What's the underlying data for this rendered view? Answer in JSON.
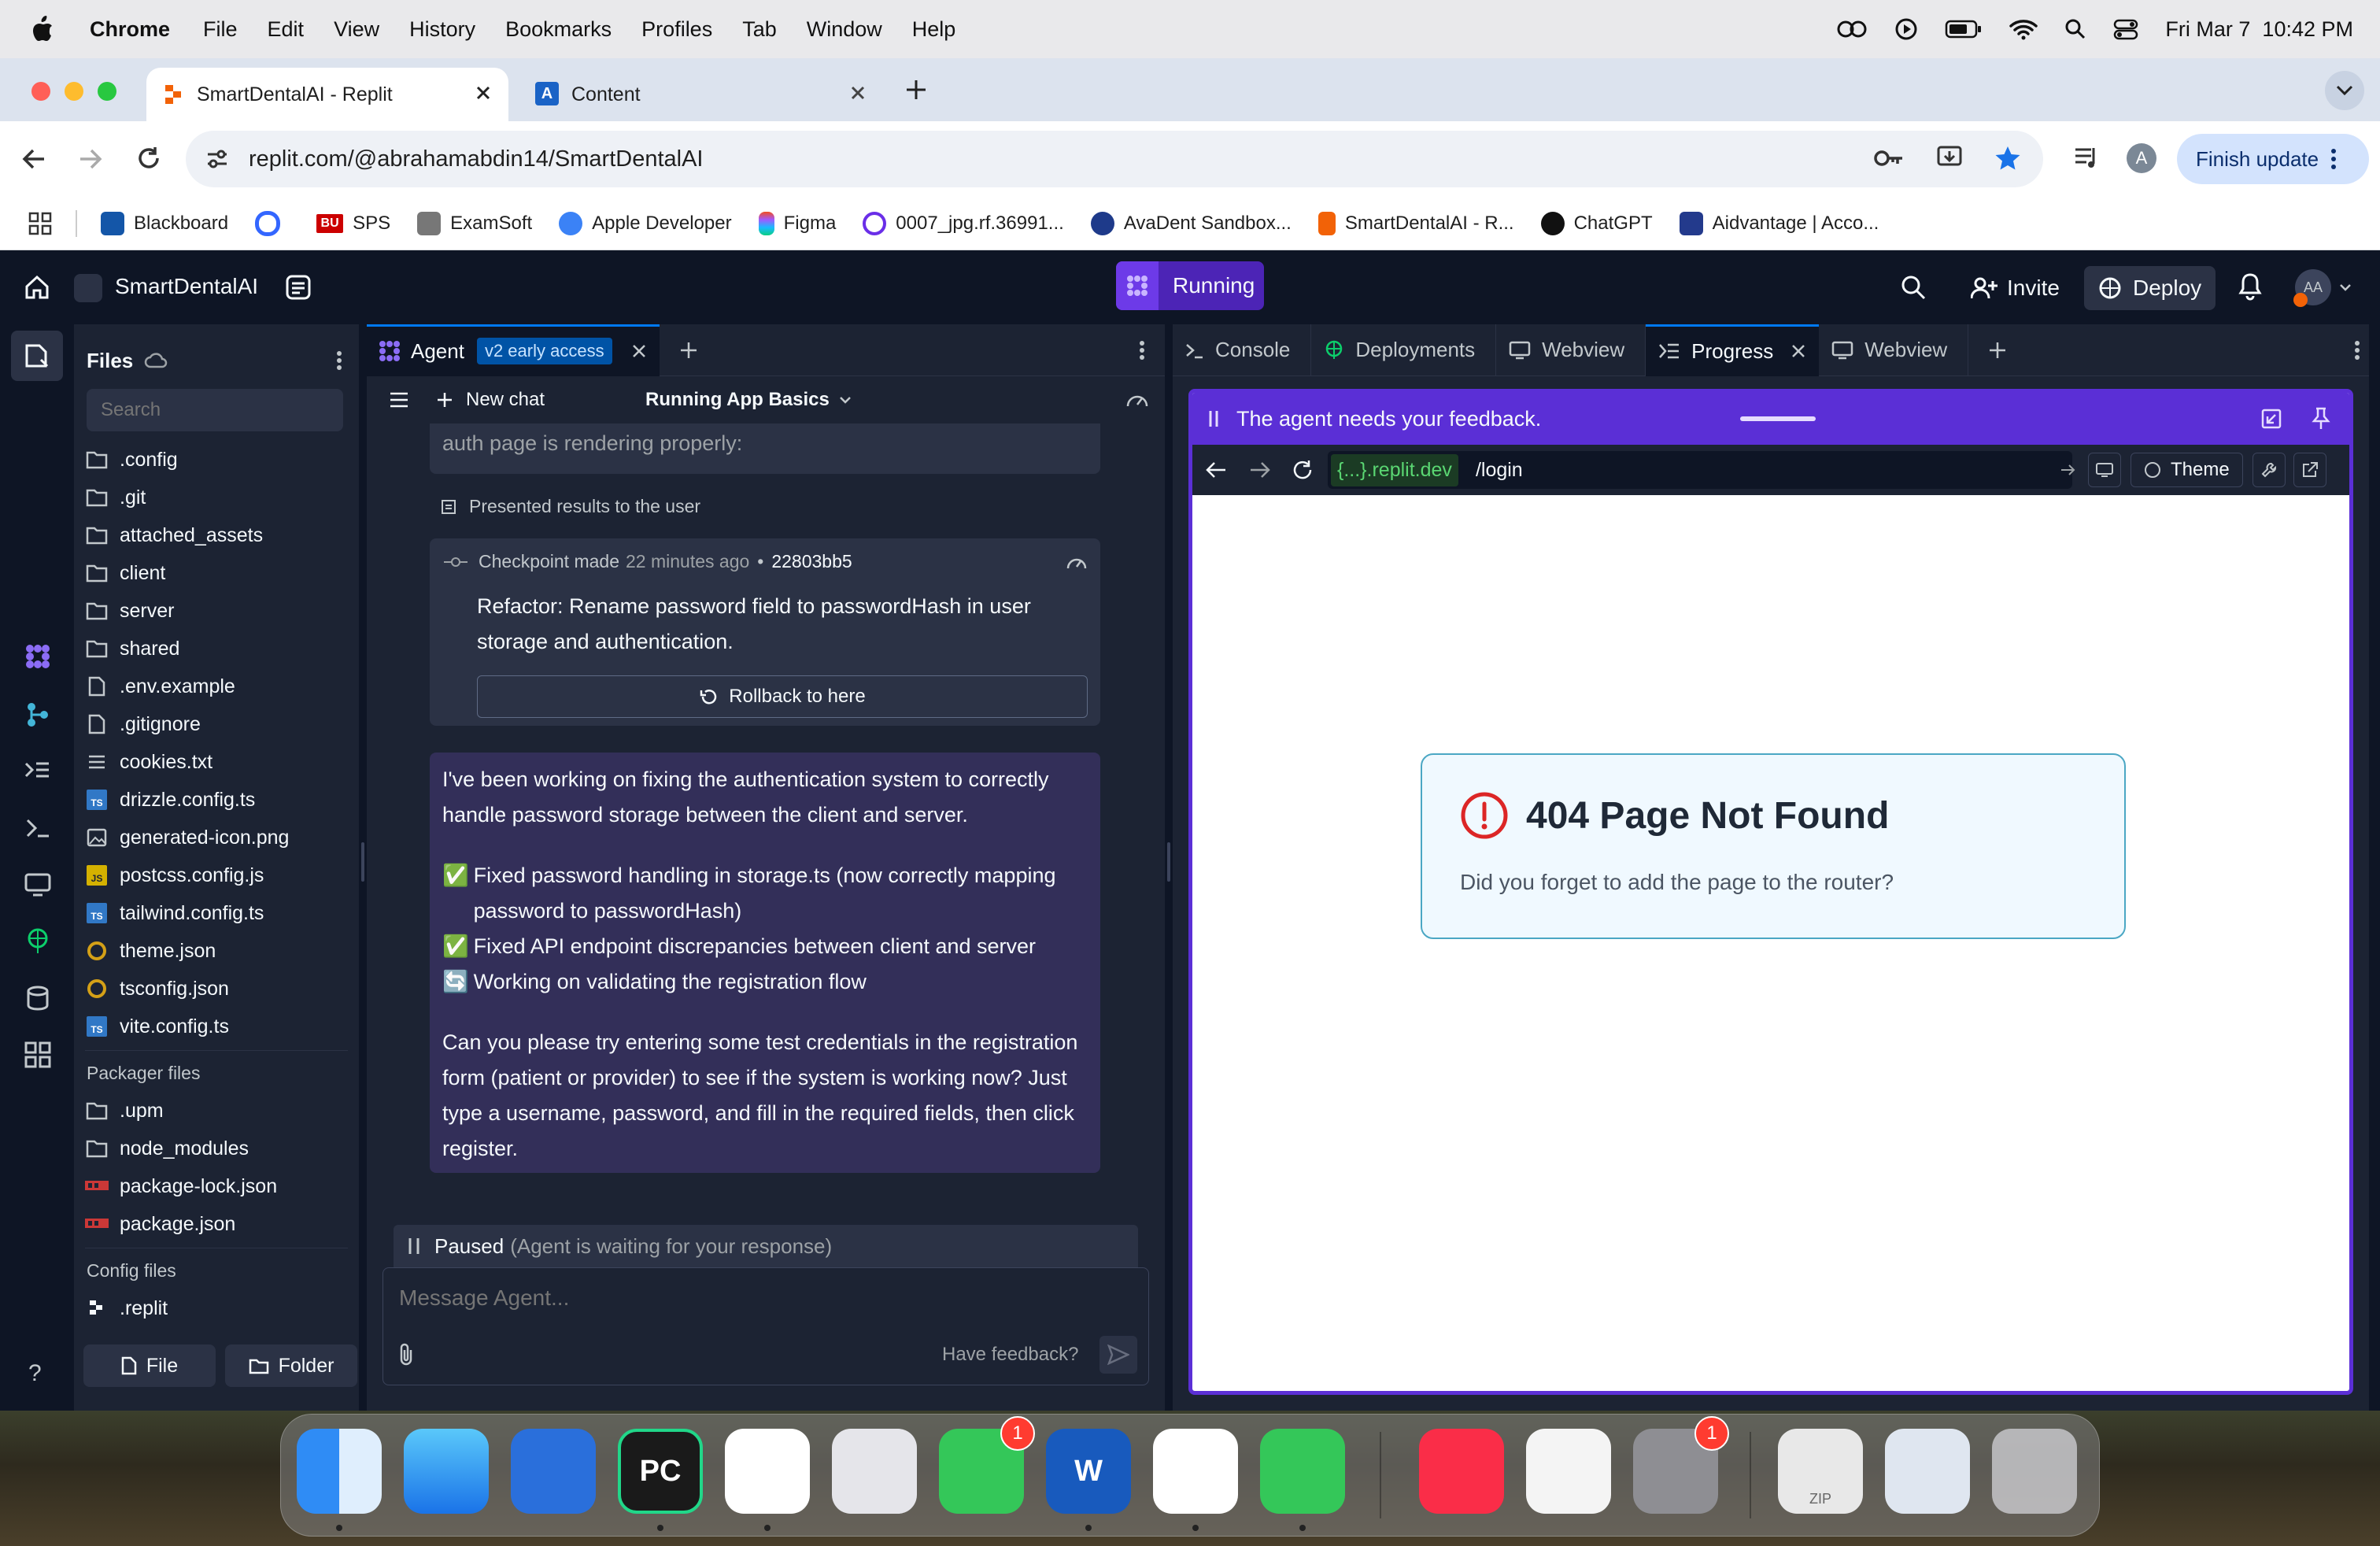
{
  "menubar": {
    "app": "Chrome",
    "items": [
      "File",
      "Edit",
      "View",
      "History",
      "Bookmarks",
      "Profiles",
      "Tab",
      "Window",
      "Help"
    ],
    "clock": "Fri Mar 7  10:42 PM"
  },
  "browser": {
    "tabs": [
      {
        "title": "SmartDentalAI - Replit",
        "active": true
      },
      {
        "title": "Content",
        "active": false
      }
    ],
    "url": "replit.com/@abrahamabdin14/SmartDentalAI",
    "profile_initial": "A",
    "finish_update": "Finish update",
    "bookmarks": [
      "Blackboard",
      "SPS",
      "ExamSoft",
      "Apple Developer",
      "Figma",
      "0007_jpg.rf.36991...",
      "AvaDent Sandbox...",
      "SmartDentalAI - R...",
      "ChatGPT",
      "Aidvantage | Acco..."
    ]
  },
  "replit": {
    "project_name": "SmartDentalAI",
    "run_label": "Running",
    "invite_label": "Invite",
    "deploy_label": "Deploy",
    "user_initials": "AA",
    "files": {
      "title": "Files",
      "search_placeholder": "Search",
      "items": [
        {
          "name": ".config",
          "icon": "folder-icon"
        },
        {
          "name": ".git",
          "icon": "folder-icon"
        },
        {
          "name": "attached_assets",
          "icon": "folder-icon"
        },
        {
          "name": "client",
          "icon": "folder-icon"
        },
        {
          "name": "server",
          "icon": "folder-icon"
        },
        {
          "name": "shared",
          "icon": "folder-icon"
        },
        {
          "name": ".env.example",
          "icon": "file-icon"
        },
        {
          "name": ".gitignore",
          "icon": "file-icon"
        },
        {
          "name": "cookies.txt",
          "icon": "text-file-icon"
        },
        {
          "name": "drizzle.config.ts",
          "icon": "ts-file-icon"
        },
        {
          "name": "generated-icon.png",
          "icon": "image-file-icon"
        },
        {
          "name": "postcss.config.js",
          "icon": "js-file-icon"
        },
        {
          "name": "tailwind.config.ts",
          "icon": "ts-file-icon"
        },
        {
          "name": "theme.json",
          "icon": "json-file-icon"
        },
        {
          "name": "tsconfig.json",
          "icon": "json-file-icon"
        },
        {
          "name": "vite.config.ts",
          "icon": "ts-file-icon"
        }
      ],
      "packager_title": "Packager files",
      "packager_items": [
        {
          "name": ".upm",
          "icon": "folder-icon"
        },
        {
          "name": "node_modules",
          "icon": "folder-icon"
        },
        {
          "name": "package-lock.json",
          "icon": "npm-file-icon"
        },
        {
          "name": "package.json",
          "icon": "npm-file-icon"
        }
      ],
      "config_title": "Config files",
      "config_items": [
        {
          "name": ".replit",
          "icon": "replit-file-icon"
        }
      ],
      "new_file_label": "File",
      "new_folder_label": "Folder"
    },
    "agent": {
      "tab_label": "Agent",
      "tab_badge": "v2 early access",
      "new_chat": "New chat",
      "chat_title": "Running App Basics",
      "prev_text": "auth page is rendering properly:",
      "presented": "Presented results to the user",
      "checkpoint_label": "Checkpoint made",
      "checkpoint_time": "22 minutes ago",
      "checkpoint_sep": "•",
      "checkpoint_hash": "22803bb5",
      "checkpoint_desc": "Refactor: Rename password field to passwordHash in user storage and authentication.",
      "rollback_label": "Rollback to here",
      "msg_intro": "I've been working on fixing the authentication system to correctly handle password storage between the client and server.",
      "msg_items": [
        {
          "icon": "✅",
          "text": "Fixed password handling in storage.ts (now correctly mapping password to passwordHash)"
        },
        {
          "icon": "✅",
          "text": "Fixed API endpoint discrepancies between client and server"
        },
        {
          "icon": "🔄",
          "text": "Working on validating the registration flow"
        }
      ],
      "msg_outro": "Can you please try entering some test credentials in the registration form (patient or provider) to see if the system is working now? Just type a username, password, and fill in the required fields, then click register.",
      "paused_label": "Paused",
      "paused_note": "(Agent is waiting for your response)",
      "input_placeholder": "Message Agent...",
      "feedback_label": "Have feedback?"
    },
    "right_tabs": [
      "Console",
      "Deployments",
      "Webview",
      "Progress",
      "Webview"
    ],
    "banner": "The agent needs your feedback.",
    "webview": {
      "domain": "{...}.replit.dev",
      "path": "/login",
      "theme_label": "Theme",
      "error_title": "404 Page Not Found",
      "error_desc": "Did you forget to add the page to the router?"
    }
  },
  "dock": {
    "apps": [
      {
        "name": "Finder"
      },
      {
        "name": "Mail"
      },
      {
        "name": "Tasks"
      },
      {
        "name": "PyCharm",
        "label": "PC"
      },
      {
        "name": "VS Code"
      },
      {
        "name": "Launchpad"
      },
      {
        "name": "FaceTime",
        "badge": "1"
      },
      {
        "name": "Word",
        "label": "W"
      },
      {
        "name": "Chrome"
      },
      {
        "name": "Messages"
      },
      {
        "name": "Music"
      },
      {
        "name": "Safari"
      },
      {
        "name": "System Settings",
        "badge": "1"
      },
      {
        "name": "Archive",
        "label": "ZIP"
      },
      {
        "name": "Screenshot"
      },
      {
        "name": "Trash"
      }
    ]
  }
}
